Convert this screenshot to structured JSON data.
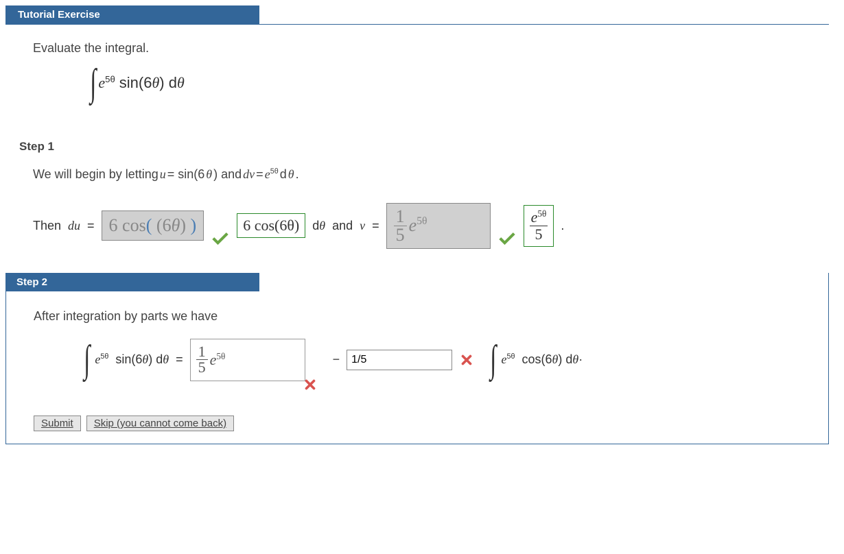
{
  "header": {
    "title": "Tutorial Exercise"
  },
  "prompt": "Evaluate the integral.",
  "integral": {
    "integrand1": "e",
    "exp1": "5θ",
    "integrand2": " sin(6",
    "theta": "θ",
    "close": ") d",
    "dtheta": "θ"
  },
  "step1": {
    "label": "Step 1",
    "line1_a": "We will begin by letting ",
    "line1_u": "u",
    "line1_b": " = sin(6",
    "line1_th": "θ",
    "line1_c": ") and ",
    "line1_dv": "dv",
    "line1_d": " = ",
    "line1_e": "e",
    "line1_exp": "5θ",
    "line1_f": " d",
    "line1_g": "θ",
    "line1_h": ".",
    "then": "Then ",
    "du": "du",
    "eq": " = ",
    "input1": "6 cos( (6θ) )",
    "ans1": "6 cos(6θ)",
    "mid": " d",
    "midth": "θ",
    "and": " and ",
    "v": "v",
    "eq2": " = ",
    "input2_num": "1",
    "input2_den": "5",
    "input2_e": "e",
    "input2_exp": "5θ",
    "ans2_top_e": "e",
    "ans2_top_exp": "5θ",
    "ans2_bot": "5",
    "period": "."
  },
  "step2": {
    "label": "Step 2",
    "line1": "After integration by parts we have",
    "lhs_e": "e",
    "lhs_exp": "5θ",
    "lhs_sin": " sin(6",
    "lhs_th": "θ",
    "lhs_close": ") d",
    "lhs_dth": "θ",
    "eq": " = ",
    "input1_num": "1",
    "input1_den": "5",
    "input1_e": "e",
    "input1_exp": "5θ",
    "minus": " − ",
    "input2": "1/5",
    "rhs_e": "e",
    "rhs_exp": "5θ",
    "rhs_cos": " cos(6",
    "rhs_th": "θ",
    "rhs_close": ") d",
    "rhs_dth": "θ",
    "rhs_dot": "·"
  },
  "buttons": {
    "submit": "Submit",
    "skip": "Skip (you cannot come back)"
  }
}
